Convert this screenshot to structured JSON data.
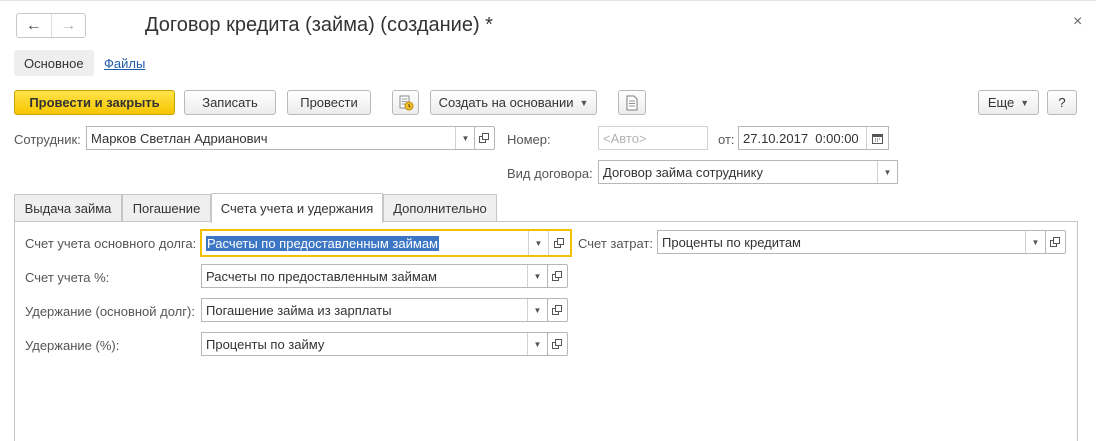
{
  "window": {
    "title": "Договор кредита (займа) (создание) *",
    "back_icon": "←",
    "forward_icon": "→",
    "close_icon": "×"
  },
  "sections": {
    "main_label": "Основное",
    "files_label": "Файлы"
  },
  "toolbar": {
    "post_close_label": "Провести и закрыть",
    "save_label": "Записать",
    "post_label": "Провести",
    "create_based_label": "Создать на основании",
    "more_label": "Еще",
    "help_label": "?"
  },
  "header": {
    "employee_label": "Сотрудник:",
    "employee_value": "Марков Светлан Адрианович",
    "number_label": "Номер:",
    "number_placeholder": "<Авто>",
    "date_label": "от:",
    "date_value": "27.10.2017  0:00:00",
    "contract_type_label": "Вид договора:",
    "contract_type_value": "Договор займа сотруднику"
  },
  "tabs": [
    {
      "label": "Выдача займа"
    },
    {
      "label": "Погашение"
    },
    {
      "label": "Счета учета и удержания"
    },
    {
      "label": "Дополнительно"
    }
  ],
  "accounts": {
    "main_debt_label": "Счет учета основного долга:",
    "main_debt_value": "Расчеты по предоставленным займам",
    "interest_label": "Счет учета %:",
    "interest_value": "Расчеты по предоставленным займам",
    "deduction_main_label": "Удержание (основной долг):",
    "deduction_main_value": "Погашение займа из зарплаты",
    "deduction_interest_label": "Удержание (%):",
    "deduction_interest_value": "Проценты по займу",
    "expense_label": "Счет затрат:",
    "expense_value": "Проценты по кредитам"
  },
  "colors": {
    "primary_button": "#f6c500",
    "focus_border": "#f3c000",
    "selection": "#3c76c4",
    "link": "#1f5ba8"
  }
}
